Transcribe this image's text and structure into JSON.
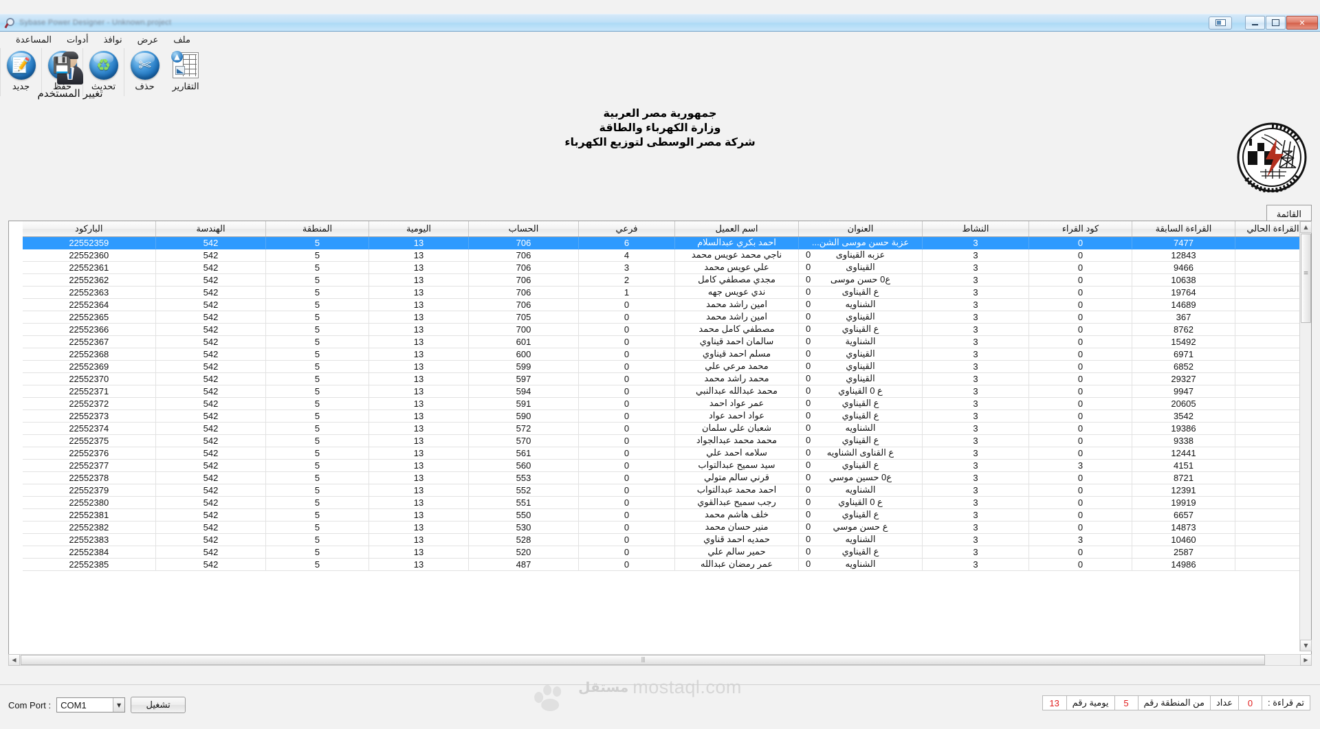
{
  "window": {
    "title": "Sybase Power Designer - Unknown.project",
    "buttons": {
      "restore_small": "restore-window",
      "minimize": "–",
      "maximize": "❐",
      "close": "✕"
    }
  },
  "menubar": {
    "items": [
      "ملف",
      "عرض",
      "نوافذ",
      "أدوات",
      "المساعدة"
    ]
  },
  "toolbar": {
    "items": [
      {
        "label": "التقارير",
        "icon": "reports-icon"
      },
      {
        "label": "حذف",
        "icon": "scissors-icon"
      },
      {
        "label": "تحديث",
        "icon": "recycle-icon"
      },
      {
        "label": "حفظ",
        "icon": "floppy-disk-icon"
      },
      {
        "label": "جديد",
        "icon": "new-document-icon"
      }
    ]
  },
  "user": {
    "label": "تغيير المستخدم",
    "avatar": "user-avatar-icon"
  },
  "header": {
    "line1": "جمهورية مصر العربية",
    "line2": "وزارة الكهرباء والطاقة",
    "line3": "شركة مصر الوسطى لتوزيع الكهرباء"
  },
  "logo": {
    "name": "electricity-company-seal-logo"
  },
  "tabs": [
    {
      "label": "القائمة",
      "active": true
    }
  ],
  "grid": {
    "columns": [
      "القراءة الحالي",
      "القراءة السابقة",
      "كود القراء",
      "النشاط",
      "العنوان",
      "اسم العميل",
      "فرعي",
      "الحساب",
      "اليومية",
      "المنطقة",
      "الهندسة",
      "الباركود"
    ],
    "rows": [
      {
        "current": "",
        "previous": "7477",
        "reader": "0",
        "activity": "3",
        "address": "عزبة حسن موسى الشن...",
        "addr_zero": "",
        "name": "احمد بكري عبدالسلام",
        "sub": "6",
        "account": "706",
        "daily": "13",
        "zone": "5",
        "eng": "542",
        "barcode": "22552359",
        "selected": true
      },
      {
        "current": "",
        "previous": "12843",
        "reader": "0",
        "activity": "3",
        "address": "عزبه القيناوى",
        "addr_zero": "0",
        "name": "ناجي محمد عويس محمد",
        "sub": "4",
        "account": "706",
        "daily": "13",
        "zone": "5",
        "eng": "542",
        "barcode": "22552360",
        "selected": false
      },
      {
        "current": "",
        "previous": "9466",
        "reader": "0",
        "activity": "3",
        "address": "القيناوى",
        "addr_zero": "0",
        "name": "علي عويس محمد",
        "sub": "3",
        "account": "706",
        "daily": "13",
        "zone": "5",
        "eng": "542",
        "barcode": "22552361",
        "selected": false
      },
      {
        "current": "",
        "previous": "10638",
        "reader": "0",
        "activity": "3",
        "address": "ع0 حسن موسى",
        "addr_zero": "0",
        "name": "مجدي مصطفي كامل",
        "sub": "2",
        "account": "706",
        "daily": "13",
        "zone": "5",
        "eng": "542",
        "barcode": "22552362",
        "selected": false
      },
      {
        "current": "",
        "previous": "19764",
        "reader": "0",
        "activity": "3",
        "address": "ع القيناوى",
        "addr_zero": "0",
        "name": "ندي عويس جهه",
        "sub": "1",
        "account": "706",
        "daily": "13",
        "zone": "5",
        "eng": "542",
        "barcode": "22552363",
        "selected": false
      },
      {
        "current": "",
        "previous": "14689",
        "reader": "0",
        "activity": "3",
        "address": "الشناويه",
        "addr_zero": "0",
        "name": "امين راشد محمد",
        "sub": "0",
        "account": "706",
        "daily": "13",
        "zone": "5",
        "eng": "542",
        "barcode": "22552364",
        "selected": false
      },
      {
        "current": "",
        "previous": "367",
        "reader": "0",
        "activity": "3",
        "address": "القيناوي",
        "addr_zero": "0",
        "name": "امين راشد محمد",
        "sub": "0",
        "account": "705",
        "daily": "13",
        "zone": "5",
        "eng": "542",
        "barcode": "22552365",
        "selected": false
      },
      {
        "current": "",
        "previous": "8762",
        "reader": "0",
        "activity": "3",
        "address": "ع القيناوي",
        "addr_zero": "0",
        "name": "مصطفي كامل محمد",
        "sub": "0",
        "account": "700",
        "daily": "13",
        "zone": "5",
        "eng": "542",
        "barcode": "22552366",
        "selected": false
      },
      {
        "current": "",
        "previous": "15492",
        "reader": "0",
        "activity": "3",
        "address": "الشناوية",
        "addr_zero": "0",
        "name": "سالمان احمد قيناوي",
        "sub": "0",
        "account": "601",
        "daily": "13",
        "zone": "5",
        "eng": "542",
        "barcode": "22552367",
        "selected": false
      },
      {
        "current": "",
        "previous": "6971",
        "reader": "0",
        "activity": "3",
        "address": "القيناوي",
        "addr_zero": "0",
        "name": "مسلم احمد قيناوي",
        "sub": "0",
        "account": "600",
        "daily": "13",
        "zone": "5",
        "eng": "542",
        "barcode": "22552368",
        "selected": false
      },
      {
        "current": "",
        "previous": "6852",
        "reader": "0",
        "activity": "3",
        "address": "القيناوي",
        "addr_zero": "0",
        "name": "محمد مرعي علي",
        "sub": "0",
        "account": "599",
        "daily": "13",
        "zone": "5",
        "eng": "542",
        "barcode": "22552369",
        "selected": false
      },
      {
        "current": "",
        "previous": "29327",
        "reader": "0",
        "activity": "3",
        "address": "القيناوي",
        "addr_zero": "0",
        "name": "محمد راشد محمد",
        "sub": "0",
        "account": "597",
        "daily": "13",
        "zone": "5",
        "eng": "542",
        "barcode": "22552370",
        "selected": false
      },
      {
        "current": "",
        "previous": "9947",
        "reader": "0",
        "activity": "3",
        "address": "ع 0 القيناوي",
        "addr_zero": "0",
        "name": "محمد عبدالله عبدالنبي",
        "sub": "0",
        "account": "594",
        "daily": "13",
        "zone": "5",
        "eng": "542",
        "barcode": "22552371",
        "selected": false
      },
      {
        "current": "",
        "previous": "20605",
        "reader": "0",
        "activity": "3",
        "address": "ع القيناوي",
        "addr_zero": "0",
        "name": "عمر عواد احمد",
        "sub": "0",
        "account": "591",
        "daily": "13",
        "zone": "5",
        "eng": "542",
        "barcode": "22552372",
        "selected": false
      },
      {
        "current": "",
        "previous": "3542",
        "reader": "0",
        "activity": "3",
        "address": "ع القيناوي",
        "addr_zero": "0",
        "name": "عواد احمد عواد",
        "sub": "0",
        "account": "590",
        "daily": "13",
        "zone": "5",
        "eng": "542",
        "barcode": "22552373",
        "selected": false
      },
      {
        "current": "",
        "previous": "19386",
        "reader": "0",
        "activity": "3",
        "address": "الشناويه",
        "addr_zero": "0",
        "name": "شعبان علي سلمان",
        "sub": "0",
        "account": "572",
        "daily": "13",
        "zone": "5",
        "eng": "542",
        "barcode": "22552374",
        "selected": false
      },
      {
        "current": "",
        "previous": "9338",
        "reader": "0",
        "activity": "3",
        "address": "ع القيناوي",
        "addr_zero": "0",
        "name": "محمد محمد عبدالجواد",
        "sub": "0",
        "account": "570",
        "daily": "13",
        "zone": "5",
        "eng": "542",
        "barcode": "22552375",
        "selected": false
      },
      {
        "current": "",
        "previous": "12441",
        "reader": "0",
        "activity": "3",
        "address": "ع القناوى  الشناويه",
        "addr_zero": "0",
        "name": "سلامه احمد علي",
        "sub": "0",
        "account": "561",
        "daily": "13",
        "zone": "5",
        "eng": "542",
        "barcode": "22552376",
        "selected": false
      },
      {
        "current": "",
        "previous": "4151",
        "reader": "3",
        "activity": "3",
        "address": "ع القيناوي",
        "addr_zero": "0",
        "name": "سيد سميح عبدالتواب",
        "sub": "0",
        "account": "560",
        "daily": "13",
        "zone": "5",
        "eng": "542",
        "barcode": "22552377",
        "selected": false
      },
      {
        "current": "",
        "previous": "8721",
        "reader": "0",
        "activity": "3",
        "address": "ع0 حسين موسي",
        "addr_zero": "0",
        "name": "قرني سالم متولي",
        "sub": "0",
        "account": "553",
        "daily": "13",
        "zone": "5",
        "eng": "542",
        "barcode": "22552378",
        "selected": false
      },
      {
        "current": "",
        "previous": "12391",
        "reader": "0",
        "activity": "3",
        "address": "الشناويه",
        "addr_zero": "0",
        "name": "احمد محمد عبدالتواب",
        "sub": "0",
        "account": "552",
        "daily": "13",
        "zone": "5",
        "eng": "542",
        "barcode": "22552379",
        "selected": false
      },
      {
        "current": "",
        "previous": "19919",
        "reader": "0",
        "activity": "3",
        "address": "ع 0 القيناوي",
        "addr_zero": "0",
        "name": "رجب سميح عبدالقوي",
        "sub": "0",
        "account": "551",
        "daily": "13",
        "zone": "5",
        "eng": "542",
        "barcode": "22552380",
        "selected": false
      },
      {
        "current": "",
        "previous": "6657",
        "reader": "0",
        "activity": "3",
        "address": "ع القيناوي",
        "addr_zero": "0",
        "name": "خلف هاشم محمد",
        "sub": "0",
        "account": "550",
        "daily": "13",
        "zone": "5",
        "eng": "542",
        "barcode": "22552381",
        "selected": false
      },
      {
        "current": "",
        "previous": "14873",
        "reader": "0",
        "activity": "3",
        "address": "ع حسن موسي",
        "addr_zero": "0",
        "name": "منير حسان محمد",
        "sub": "0",
        "account": "530",
        "daily": "13",
        "zone": "5",
        "eng": "542",
        "barcode": "22552382",
        "selected": false
      },
      {
        "current": "",
        "previous": "10460",
        "reader": "3",
        "activity": "3",
        "address": "الشناويه",
        "addr_zero": "0",
        "name": "حمديه احمد قناوي",
        "sub": "0",
        "account": "528",
        "daily": "13",
        "zone": "5",
        "eng": "542",
        "barcode": "22552383",
        "selected": false
      },
      {
        "current": "",
        "previous": "2587",
        "reader": "0",
        "activity": "3",
        "address": "ع القيناوي",
        "addr_zero": "0",
        "name": "حمير سالم علي",
        "sub": "0",
        "account": "520",
        "daily": "13",
        "zone": "5",
        "eng": "542",
        "barcode": "22552384",
        "selected": false
      },
      {
        "current": "",
        "previous": "14986",
        "reader": "0",
        "activity": "3",
        "address": "الشناويه",
        "addr_zero": "0",
        "name": "عمر رمضان عبدالله",
        "sub": "0",
        "account": "487",
        "daily": "13",
        "zone": "5",
        "eng": "542",
        "barcode": "22552385",
        "selected": false
      }
    ]
  },
  "bottom": {
    "comport_label": "Com Port :",
    "comport_value": "COM1",
    "run_button": "تشغيل",
    "status": {
      "prefix": "تم قراءة :",
      "count": "0",
      "meter_label": "عداد",
      "zone_label": "من المنطقة رقم",
      "zone_value": "5",
      "daily_label": "يومية رقم",
      "daily_value": "13"
    }
  },
  "watermark": {
    "arabic": "مستقل",
    "english": "mostaql.com"
  }
}
